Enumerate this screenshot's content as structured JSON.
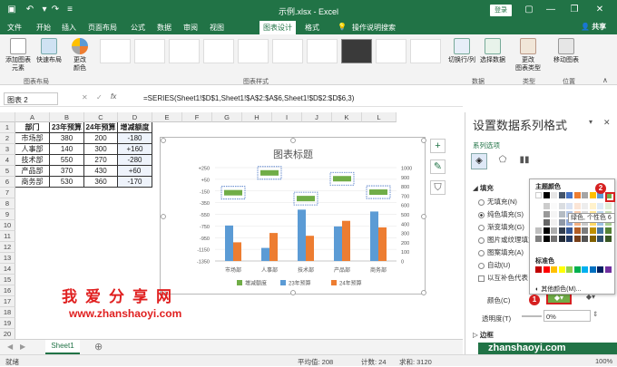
{
  "window": {
    "title": "示例.xlsx  -  Excel",
    "login": "登录"
  },
  "menu": [
    "文件",
    "开始",
    "插入",
    "页面布局",
    "公式",
    "数据",
    "审阅",
    "视图",
    "图表设计",
    "格式"
  ],
  "tell_me": "操作说明搜索",
  "share": "共享",
  "ribbon": {
    "add_element": "添加图表\n元素",
    "quick_layout": "快速布局",
    "change_colors": "更改\n颜色",
    "switch_rowcol": "切换行/列",
    "select_data": "选择数据",
    "change_type": "更改\n图表类型",
    "move_chart": "移动图表",
    "group_layout": "图表布局",
    "group_styles": "图表样式",
    "group_data": "数据",
    "group_type": "类型",
    "group_location": "位置"
  },
  "formula_bar": {
    "name_box": "图表 2",
    "formula": "=SERIES(Sheet1!$D$1,Sheet1!$A$2:$A$6,Sheet1!$D$2:$D$6,3)"
  },
  "columns": [
    "A",
    "B",
    "C",
    "D",
    "E",
    "F",
    "G",
    "H",
    "I",
    "J",
    "K",
    "L"
  ],
  "rows": [
    "1",
    "2",
    "3",
    "4",
    "5",
    "6",
    "7",
    "8",
    "9",
    "10",
    "11",
    "12",
    "13",
    "14",
    "15",
    "16",
    "17",
    "18",
    "19",
    "20"
  ],
  "table": {
    "headers": [
      "部门",
      "23年预算",
      "24年预算",
      "增减额度"
    ],
    "rows": [
      [
        "市场部",
        "380",
        "200",
        "-180"
      ],
      [
        "人事部",
        "140",
        "300",
        "+160"
      ],
      [
        "技术部",
        "550",
        "270",
        "-280"
      ],
      [
        "产品部",
        "370",
        "430",
        "+60"
      ],
      [
        "商务部",
        "530",
        "360",
        "-170"
      ]
    ]
  },
  "chart_data": {
    "type": "bar",
    "title": "图表标题",
    "categories": [
      "市场部",
      "人事部",
      "技术部",
      "产品部",
      "商务部"
    ],
    "series": [
      {
        "name": "增减额度",
        "values": [
          -180,
          160,
          -280,
          60,
          -170
        ],
        "axis": "left",
        "color": "#70ad47",
        "display": "line markers"
      },
      {
        "name": "23年预算",
        "values": [
          380,
          140,
          550,
          370,
          530
        ],
        "axis": "right",
        "color": "#5b9bd5"
      },
      {
        "name": "24年预算",
        "values": [
          200,
          300,
          270,
          430,
          360
        ],
        "axis": "right",
        "color": "#ed7d31"
      }
    ],
    "left_axis": {
      "ticks": [
        "+250",
        "+50",
        "-150",
        "-350",
        "-550",
        "-750",
        "-950",
        "-1150",
        "-1350"
      ],
      "ylim": [
        -1350,
        250
      ]
    },
    "right_axis": {
      "ticks": [
        "1000",
        "900",
        "800",
        "700",
        "600",
        "500",
        "400",
        "300",
        "200",
        "100",
        "0"
      ],
      "ylim": [
        0,
        1000
      ]
    },
    "legend": "bottom",
    "grid": true
  },
  "watermark": {
    "line1": "我爱分享网",
    "line2": "www.zhanshaoyi.com",
    "line3": "zhanshaoyi.com"
  },
  "sheet_tab": "Sheet1",
  "status": {
    "ready": "就绪",
    "average": "平均值: 208",
    "count": "计数: 24",
    "sum": "求和: 3120",
    "zoom": "100%"
  },
  "pane": {
    "title": "设置数据系列格式",
    "series_options": "系列选项",
    "fill_section": "填充",
    "fill_options": [
      "无填充(N)",
      "纯色填充(S)",
      "渐变填充(G)",
      "图片或纹理填充",
      "图案填充(A)",
      "自动(U)",
      "以互补色代表"
    ],
    "color_label": "颜色(C)",
    "transparency_label": "透明度(T)",
    "transparency_value": "0%",
    "border_section": "边框"
  },
  "popup": {
    "theme_colors": "主题颜色",
    "standard_colors": "标准色",
    "more_colors": "其他颜色(M)...",
    "tooltip": "绿色, 个性色 6"
  },
  "badges": [
    "1",
    "2"
  ]
}
